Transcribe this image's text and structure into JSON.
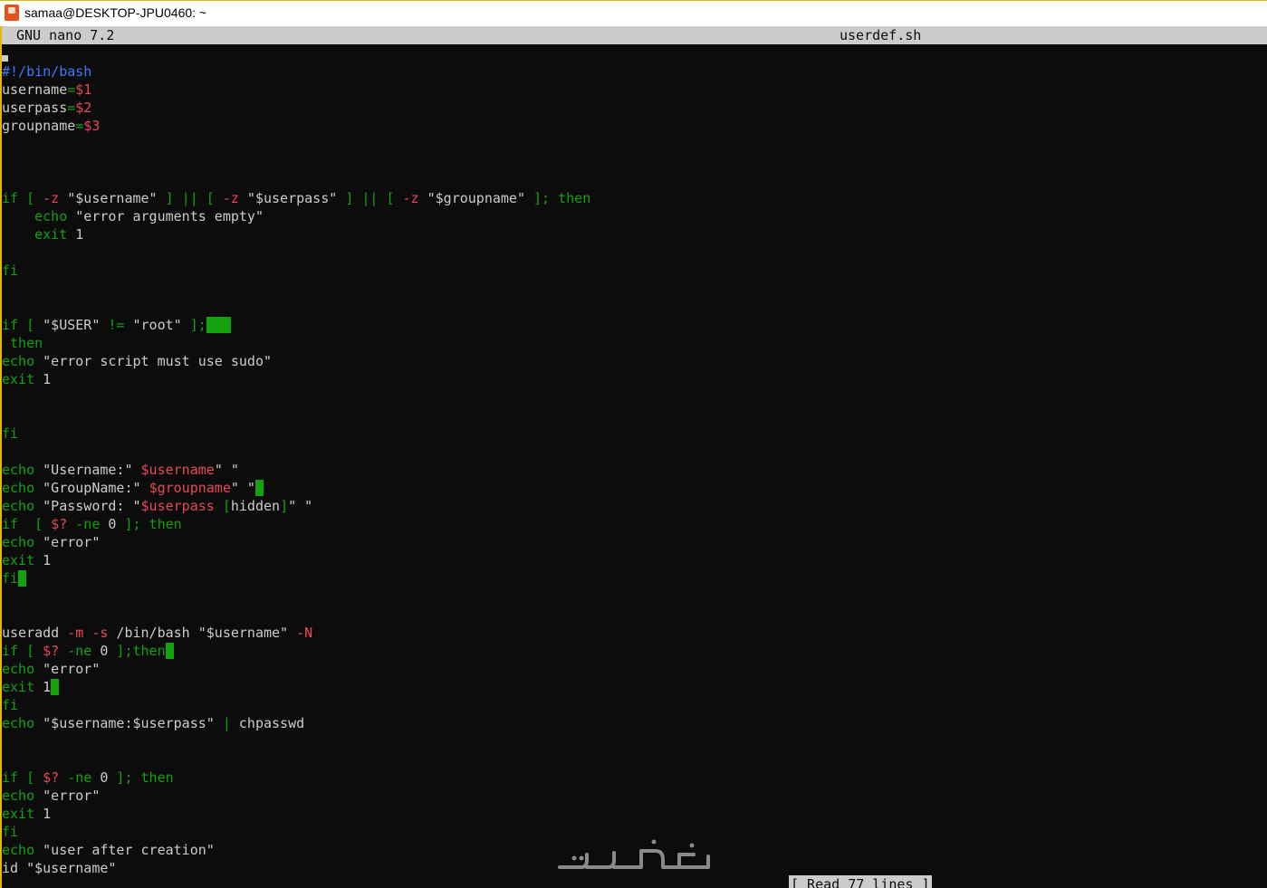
{
  "window": {
    "title": "samaa@DESKTOP-JPU0460: ~"
  },
  "nano": {
    "version": "GNU nano 7.2",
    "filename": "userdef.sh",
    "status": "[ Read 77 lines ]"
  },
  "watermark": {
    "text": "خمسات"
  },
  "colors": {
    "background": "#0c0c0c",
    "keyword": "#13a10e",
    "variable": "#e74856",
    "comment": "#3b78ff",
    "text": "#cccccc"
  },
  "lines": [
    {
      "row": 1,
      "segs": [
        [
          "#!/bin/bash",
          "cmt"
        ]
      ]
    },
    {
      "row": 2,
      "segs": [
        [
          "username",
          ""
        ],
        [
          "=",
          "op"
        ],
        [
          "$1",
          "var"
        ]
      ]
    },
    {
      "row": 3,
      "segs": [
        [
          "userpass",
          ""
        ],
        [
          "=",
          "op"
        ],
        [
          "$2",
          "var"
        ]
      ]
    },
    {
      "row": 4,
      "segs": [
        [
          "groupname",
          ""
        ],
        [
          "=",
          "op"
        ],
        [
          "$3",
          "var"
        ]
      ]
    },
    {
      "row": 8,
      "segs": [
        [
          "if [ ",
          "kw"
        ],
        [
          "-z",
          "var"
        ],
        [
          " \"$username\" ",
          ""
        ],
        [
          "] || [ ",
          "kw"
        ],
        [
          "-z",
          "var"
        ],
        [
          " \"$userpass\" ",
          ""
        ],
        [
          "] || [ ",
          "kw"
        ],
        [
          "-z",
          "var"
        ],
        [
          " \"$groupname\" ",
          ""
        ],
        [
          "]; then",
          "kw"
        ]
      ]
    },
    {
      "row": 9,
      "segs": [
        [
          "    ",
          ""
        ],
        [
          "echo",
          "kw"
        ],
        [
          " \"error arguments empty\"",
          ""
        ]
      ]
    },
    {
      "row": 10,
      "segs": [
        [
          "    ",
          ""
        ],
        [
          "exit",
          "kw"
        ],
        [
          " 1",
          ""
        ]
      ]
    },
    {
      "row": 12,
      "segs": [
        [
          "fi",
          "kw"
        ]
      ]
    },
    {
      "row": 15,
      "segs": [
        [
          "if [ ",
          "kw"
        ],
        [
          "\"$USER\" ",
          ""
        ],
        [
          "!=",
          "kw"
        ],
        [
          " \"root\" ",
          ""
        ],
        [
          "];",
          "kw"
        ],
        [
          "   ",
          "hl"
        ]
      ]
    },
    {
      "row": 16,
      "segs": [
        [
          " then",
          "kw"
        ]
      ]
    },
    {
      "row": 17,
      "segs": [
        [
          "echo",
          "kw"
        ],
        [
          " \"error script must use sudo\"",
          ""
        ]
      ]
    },
    {
      "row": 18,
      "segs": [
        [
          "exit",
          "kw"
        ],
        [
          " 1",
          ""
        ]
      ]
    },
    {
      "row": 21,
      "segs": [
        [
          "fi",
          "kw"
        ]
      ]
    },
    {
      "row": 23,
      "segs": [
        [
          "echo",
          "kw"
        ],
        [
          " \"Username:\" ",
          ""
        ],
        [
          "$username",
          "var"
        ],
        [
          "\" \"",
          ""
        ]
      ]
    },
    {
      "row": 24,
      "segs": [
        [
          "echo",
          "kw"
        ],
        [
          " \"GroupName:\" ",
          ""
        ],
        [
          "$groupname",
          "var"
        ],
        [
          "\" \"",
          ""
        ],
        [
          " ",
          "hl"
        ]
      ]
    },
    {
      "row": 25,
      "segs": [
        [
          "echo",
          "kw"
        ],
        [
          " \"Password: \"",
          ""
        ],
        [
          "$userpass",
          "var"
        ],
        [
          " [",
          "kw"
        ],
        [
          "hidden",
          ""
        ],
        [
          "]",
          "kw"
        ],
        [
          "\" \"",
          ""
        ]
      ]
    },
    {
      "row": 26,
      "segs": [
        [
          "if  [ ",
          "kw"
        ],
        [
          "$?",
          "var"
        ],
        [
          " -ne ",
          "kw"
        ],
        [
          "0",
          ""
        ],
        [
          " ]; then",
          "kw"
        ]
      ]
    },
    {
      "row": 27,
      "segs": [
        [
          "echo",
          "kw"
        ],
        [
          " \"error\"",
          ""
        ]
      ]
    },
    {
      "row": 28,
      "segs": [
        [
          "exit",
          "kw"
        ],
        [
          " 1",
          ""
        ]
      ]
    },
    {
      "row": 29,
      "segs": [
        [
          "fi",
          "kw"
        ],
        [
          " ",
          "hl"
        ]
      ]
    },
    {
      "row": 32,
      "segs": [
        [
          "useradd ",
          ""
        ],
        [
          "-m -s",
          "var"
        ],
        [
          " /bin/bash \"$username\" ",
          ""
        ],
        [
          "-N",
          "var"
        ]
      ]
    },
    {
      "row": 33,
      "segs": [
        [
          "if [ ",
          "kw"
        ],
        [
          "$?",
          "var"
        ],
        [
          " -ne ",
          "kw"
        ],
        [
          "0",
          ""
        ],
        [
          " ];then",
          "kw"
        ],
        [
          " ",
          "hl"
        ]
      ]
    },
    {
      "row": 34,
      "segs": [
        [
          "echo",
          "kw"
        ],
        [
          " \"error\"",
          ""
        ]
      ]
    },
    {
      "row": 35,
      "segs": [
        [
          "exit",
          "kw"
        ],
        [
          " 1",
          ""
        ],
        [
          " ",
          "hl"
        ]
      ]
    },
    {
      "row": 36,
      "segs": [
        [
          "fi",
          "kw"
        ]
      ]
    },
    {
      "row": 37,
      "segs": [
        [
          "echo",
          "kw"
        ],
        [
          " \"$username:$userpass\" ",
          ""
        ],
        [
          "|",
          "kw"
        ],
        [
          " chpasswd",
          ""
        ]
      ]
    },
    {
      "row": 40,
      "segs": [
        [
          "if [ ",
          "kw"
        ],
        [
          "$?",
          "var"
        ],
        [
          " -ne ",
          "kw"
        ],
        [
          "0",
          ""
        ],
        [
          " ]; then",
          "kw"
        ]
      ]
    },
    {
      "row": 41,
      "segs": [
        [
          "echo",
          "kw"
        ],
        [
          " \"error\"",
          ""
        ]
      ]
    },
    {
      "row": 42,
      "segs": [
        [
          "exit",
          "kw"
        ],
        [
          " 1",
          ""
        ]
      ]
    },
    {
      "row": 43,
      "segs": [
        [
          "fi",
          "kw"
        ]
      ]
    },
    {
      "row": 44,
      "segs": [
        [
          "echo",
          "kw"
        ],
        [
          " \"user after creation\"",
          ""
        ]
      ]
    },
    {
      "row": 45,
      "segs": [
        [
          "id \"$username\"",
          ""
        ]
      ]
    }
  ]
}
